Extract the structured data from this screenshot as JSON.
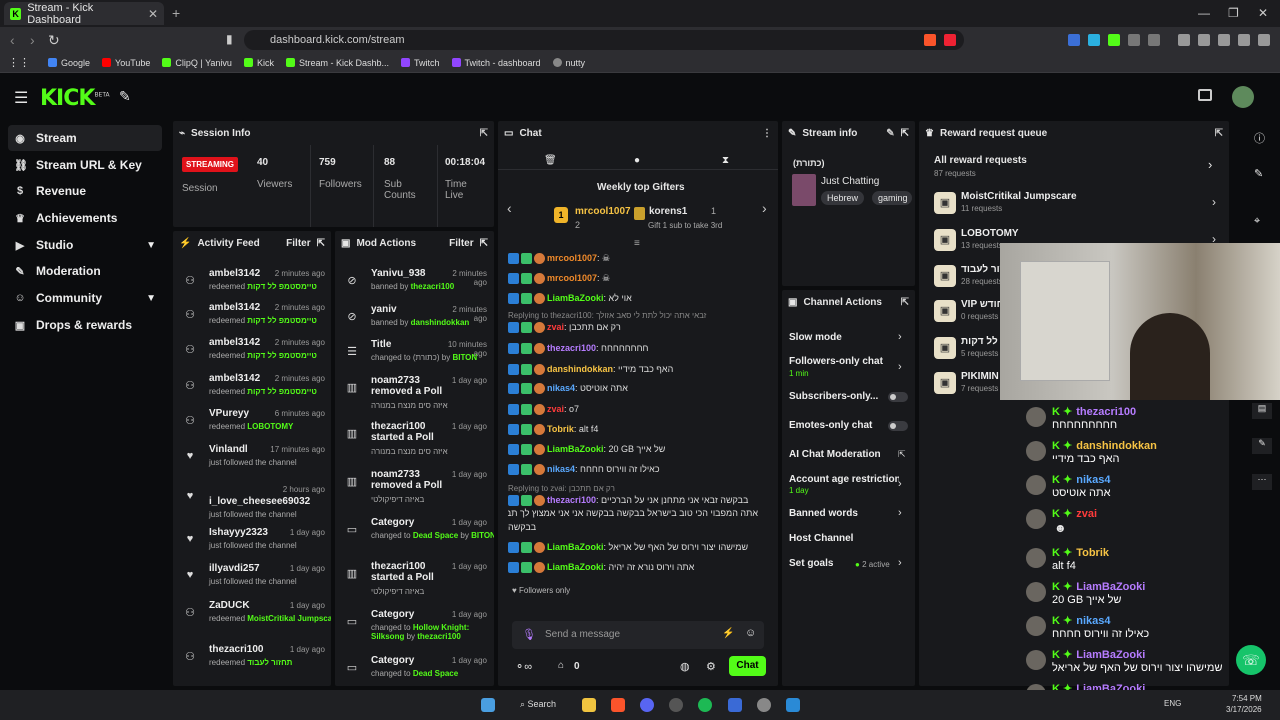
{
  "browser": {
    "tab_title": "Stream - Kick Dashboard",
    "url": "dashboard.kick.com/stream",
    "bookmarks": [
      "Google",
      "YouTube",
      "ClipQ | Yanivu",
      "Kick",
      "Stream - Kick Dashb...",
      "Twitch",
      "Twitch - dashboard",
      "nutty"
    ]
  },
  "kick": {
    "logo": "KICK",
    "beta": "BETA"
  },
  "sidebar": {
    "items": [
      {
        "label": "Stream",
        "icon": "radio-icon"
      },
      {
        "label": "Stream URL & Key",
        "icon": "link-icon"
      },
      {
        "label": "Revenue",
        "icon": "dollar-icon"
      },
      {
        "label": "Achievements",
        "icon": "trophy-icon"
      },
      {
        "label": "Studio",
        "icon": "video-icon"
      },
      {
        "label": "Moderation",
        "icon": "wrench-icon"
      },
      {
        "label": "Community",
        "icon": "users-icon"
      },
      {
        "label": "Drops & rewards",
        "icon": "gift-icon"
      }
    ]
  },
  "session": {
    "title": "Session Info",
    "status": "STREAMING",
    "status_label": "Session",
    "viewers": "40",
    "viewers_label": "Viewers",
    "followers": "759",
    "followers_label": "Followers",
    "subs": "88",
    "subs_label": "Sub Counts",
    "time": "00:18:04",
    "time_label": "Time Live"
  },
  "activity": {
    "title": "Activity Feed",
    "filter": "Filter",
    "items": [
      {
        "name": "ambel3142",
        "time": "2 minutes ago",
        "action": "redeemed",
        "reward": "טיימסטמפ לל דקות"
      },
      {
        "name": "ambel3142",
        "time": "2 minutes ago",
        "action": "redeemed",
        "reward": "טיימסטמפ לל דקות"
      },
      {
        "name": "ambel3142",
        "time": "2 minutes ago",
        "action": "redeemed",
        "reward": "טיימסטמפ לל דקות"
      },
      {
        "name": "ambel3142",
        "time": "2 minutes ago",
        "action": "redeemed",
        "reward": "טיימסטמפ לל דקות"
      },
      {
        "name": "VPureyy",
        "time": "6 minutes ago",
        "action": "redeemed",
        "reward": "LOBOTOMY"
      },
      {
        "name": "Vinlandl",
        "time": "17 minutes ago",
        "action": "just followed the channel",
        "reward": ""
      },
      {
        "name": "i_love_cheesee69032",
        "time": "2 hours ago",
        "action": "just followed the channel",
        "reward": ""
      },
      {
        "name": "Ishayyy2323",
        "time": "1 day ago",
        "action": "just followed the channel",
        "reward": ""
      },
      {
        "name": "illyavdi257",
        "time": "1 day ago",
        "action": "just followed the channel",
        "reward": ""
      },
      {
        "name": "ZaDUCK",
        "time": "1 day ago",
        "action": "redeemed",
        "reward": "MoistCritikal Jumpscare"
      },
      {
        "name": "thezacri100",
        "time": "1 day ago",
        "action": "redeemed",
        "reward": "תחזור לעבוד"
      }
    ]
  },
  "mod": {
    "title": "Mod Actions",
    "filter": "Filter",
    "items": [
      {
        "name": "Yanivu_938",
        "time": "2 minutes ago",
        "line": "banned by",
        "by": "thezacri100"
      },
      {
        "name": "yaniv",
        "time": "2 minutes ago",
        "line": "banned by",
        "by": "danshindokkan"
      },
      {
        "name": "Title",
        "time": "10 minutes ago",
        "line": "changed to (כתורת) by",
        "by": "BITON"
      },
      {
        "name": "noam2733",
        "name2": "removed a Poll",
        "time": "1 day ago",
        "line": "איזה סים מנצח במנורה",
        "by": ""
      },
      {
        "name": "thezacri100",
        "name2": "started a Poll",
        "time": "1 day ago",
        "line": "איזה סים מנצח במנורה",
        "by": ""
      },
      {
        "name": "noam2733",
        "name2": "removed a Poll",
        "time": "1 day ago",
        "line": "באיזה דיפיקולטי",
        "by": ""
      },
      {
        "name": "Category",
        "time": "1 day ago",
        "line": "changed to",
        "by": "Dead Space",
        "line2": "BITON"
      },
      {
        "name": "thezacri100",
        "name2": "started a Poll",
        "time": "1 day ago",
        "line": "באיזה דיפיקולטי",
        "by": ""
      },
      {
        "name": "Category",
        "time": "1 day ago",
        "line": "changed to",
        "by": "Hollow Knight: Silksong",
        "line2": "thezacri100"
      },
      {
        "name": "Category",
        "time": "1 day ago",
        "line": "changed to",
        "by": "Dead Space",
        "line2": ""
      }
    ]
  },
  "chat": {
    "title": "Chat",
    "gifters_title": "Weekly top Gifters",
    "gifter1": "mrcool1007",
    "gifter1_count": "2",
    "gifter2": "korens1",
    "gifter2_count": "1",
    "gifter_hint": "Gift 1 sub to take 3rd",
    "messages": [
      {
        "user": "mrcool1007",
        "color": "#f08a2a",
        "text": ""
      },
      {
        "user": "mrcool1007",
        "color": "#f08a2a",
        "text": ""
      },
      {
        "user": "LiamBaZooki",
        "color": "#53fc18",
        "text": "אוי לא"
      },
      {
        "reply": "Replying to thezacri100: זבאי אתה יכול לתת לי סאב אזולך",
        "user": "zvai",
        "color": "#ff3b3b",
        "text": "רק אם תתכבן"
      },
      {
        "user": "thezacri100",
        "color": "#b67cff",
        "text": "חחחחחחחח"
      },
      {
        "user": "danshindokkan",
        "color": "#f6c344",
        "text": "האף כבד מידיי"
      },
      {
        "user": "nikas4",
        "color": "#5aa9ff",
        "text": "אתה אוטיסט"
      },
      {
        "user": "zvai",
        "color": "#ff3b3b",
        "text": "o7"
      },
      {
        "user": "Tobrik",
        "color": "#f6c344",
        "text": "alt f4"
      },
      {
        "user": "LiamBaZooki",
        "color": "#53fc18",
        "text": "20 GB של אייך"
      },
      {
        "user": "nikas4",
        "color": "#5aa9ff",
        "text": "כאילו זה ווירוס חחחח"
      },
      {
        "reply": "Replying to zvai: רק אם תתכבן",
        "user": "thezacri100",
        "color": "#b67cff",
        "text": "בבקשה זבאי אני מתחנן אני על הברכיים"
      },
      {
        "user": "LiamBaZooki",
        "color": "#53fc18",
        "text": "שמישהו יצור וירוס של האף של אריאל"
      },
      {
        "user": "LiamBaZooki",
        "color": "#53fc18",
        "text": "אתה וירוס נורא זה יהיה"
      }
    ],
    "long_line2": "אתה המפבוי הכי טוב בישראל בבקשה בבקשה אני אני אמצוץ לך תבוהן",
    "long_line3": "בבקשה",
    "followers_only": "Followers only",
    "placeholder": "Send a message",
    "points": "0",
    "send": "Chat"
  },
  "stream_info": {
    "title": "Stream info",
    "stream_title": "(כתורת)",
    "category": "Just Chatting",
    "tags": [
      "Hebrew",
      "gaming"
    ]
  },
  "channel_actions": {
    "title": "Channel Actions",
    "items": [
      "Slow mode",
      "Followers-only chat",
      "Subscribers-only...",
      "Emotes-only chat",
      "AI Chat Moderation",
      "Account age restriction",
      "Banned words",
      "Host Channel",
      "Set goals"
    ],
    "followers_sub": "1 min",
    "age_sub": "1 day",
    "goals_sub": "2 active"
  },
  "reward_queue": {
    "title": "Reward request queue",
    "all": "All reward requests",
    "all_count": "87 requests",
    "items": [
      {
        "title": "MoistCritikal Jumpscare",
        "count": "11 requests"
      },
      {
        "title": "LOBOTOMY",
        "count": "13 requests"
      },
      {
        "title": "תחזור לעבוד",
        "count": "28 requests"
      },
      {
        "title": "VIP לחודש",
        "count": "0 requests"
      },
      {
        "title": "טיימסטמפ לל דקות",
        "count": "5 requests"
      },
      {
        "title": "PIKIMIN",
        "count": "7 requests"
      }
    ]
  },
  "overlay_chat": [
    {
      "user": "thezacri100",
      "color": "#b67cff",
      "text": "חחחחחחחחח"
    },
    {
      "user": "danshindokkan",
      "color": "#f6c344",
      "text": "האף כבד מידיי"
    },
    {
      "user": "nikas4",
      "color": "#5aa9ff",
      "text": "אתה אוטיסט"
    },
    {
      "user": "zvai",
      "color": "#ff3b3b",
      "text": ""
    },
    {
      "user": "Tobrik",
      "color": "#f6c344",
      "text": "alt f4"
    },
    {
      "user": "LiamBaZooki",
      "color": "#b67cff",
      "text": "20 GB של אייך"
    },
    {
      "user": "nikas4",
      "color": "#5aa9ff",
      "text": "כאילו זה ווירוס חחחח"
    },
    {
      "user": "LiamBaZooki",
      "color": "#b67cff",
      "text": "שמישהו יצור וירוס של האף של אריאל"
    },
    {
      "user": "LiamBaZooki",
      "color": "#b67cff",
      "text": "אתה וירוס נורא זה יהיה"
    }
  ],
  "taskbar": {
    "search": "Search",
    "lang": "ENG",
    "time": "7:54 PM",
    "date": "3/17/2026"
  }
}
